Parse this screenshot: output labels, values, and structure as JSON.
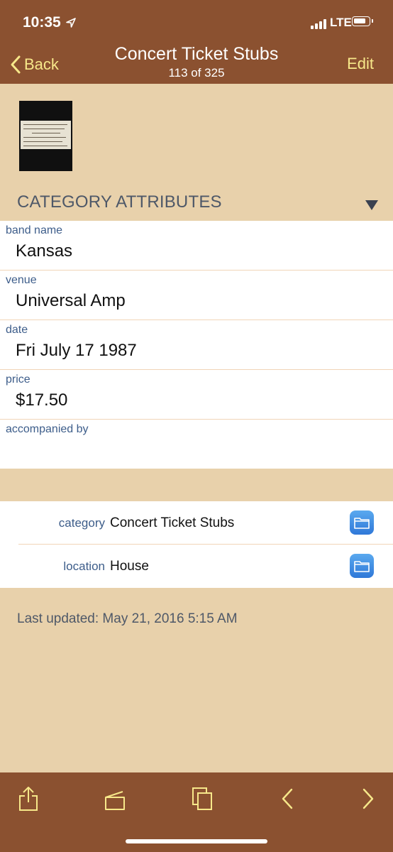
{
  "status": {
    "time": "10:35",
    "network": "LTE"
  },
  "nav": {
    "back_label": "Back",
    "title": "Concert Ticket Stubs",
    "subtitle": "113 of 325",
    "edit_label": "Edit"
  },
  "section": {
    "header": "CATEGORY ATTRIBUTES"
  },
  "attributes": [
    {
      "label": "band name",
      "value": "Kansas"
    },
    {
      "label": "venue",
      "value": "Universal Amp"
    },
    {
      "label": "date",
      "value": "Fri July 17 1987"
    },
    {
      "label": "price",
      "value": "$17.50"
    },
    {
      "label": "accompanied by",
      "value": ""
    }
  ],
  "info": {
    "category_label": "category",
    "category_value": "Concert Ticket Stubs",
    "location_label": "location",
    "location_value": "House"
  },
  "footer": {
    "last_updated": "Last updated: May 21, 2016 5:15 AM"
  },
  "colors": {
    "brown": "#8b5130",
    "tan": "#e8d1ab",
    "accent": "#f7e88a",
    "label_blue": "#3d5d8a"
  },
  "toolbar": {
    "icons": [
      "share-icon",
      "tag-icon",
      "duplicate-icon",
      "previous-icon",
      "next-icon"
    ]
  }
}
